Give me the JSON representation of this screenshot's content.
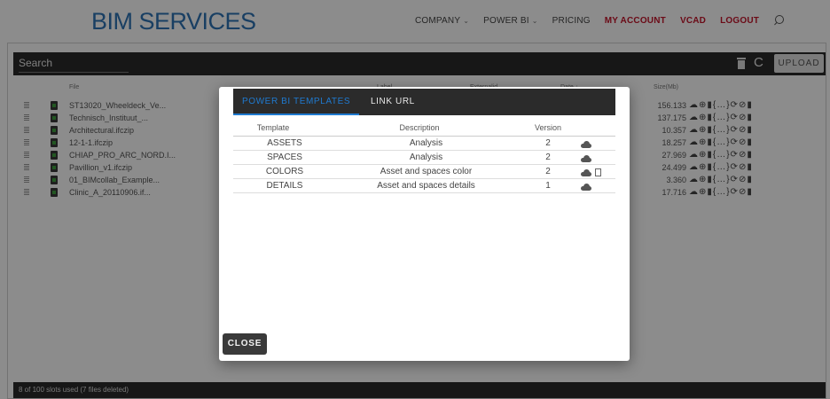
{
  "header": {
    "logo": "BIM SERVICES",
    "nav": [
      {
        "label": "COMPANY",
        "caret": "⌄",
        "highlight": false
      },
      {
        "label": "POWER BI",
        "caret": "⌄",
        "highlight": false
      },
      {
        "label": "PRICING",
        "caret": "",
        "highlight": false
      },
      {
        "label": "MY ACCOUNT",
        "caret": "",
        "highlight": true
      },
      {
        "label": "VCAD",
        "caret": "",
        "highlight": true
      },
      {
        "label": "LOGOUT",
        "caret": "",
        "highlight": true
      }
    ],
    "search_icon": "search-icon"
  },
  "toolbar": {
    "search_placeholder": "Search",
    "refresh_glyph": "C",
    "upload_label": "UPLOAD"
  },
  "table": {
    "headers": {
      "file": "File",
      "label": "Label",
      "externalid": "Externalid",
      "date": "Date ↓",
      "size": "Size(Mb)"
    },
    "rows": [
      {
        "name": "ST13020_Wheeldeck_Ve...",
        "size": "156.133"
      },
      {
        "name": "Technisch_Instituut_...",
        "size": "137.175"
      },
      {
        "name": "Architectural.ifczip",
        "size": "10.357"
      },
      {
        "name": "12-1-1.ifczip",
        "size": "18.257"
      },
      {
        "name": "CHIAP_PRO_ARC_NORD.I...",
        "size": "27.969"
      },
      {
        "name": "Pavillion_v1.ifczip",
        "size": "24.499"
      },
      {
        "name": "01_BIMcollab_Example...",
        "size": "3.360"
      },
      {
        "name": "Clinic_A_20110906.if...",
        "size": "17.716"
      }
    ],
    "action_glyphs": "☁⊕▮{…}⟳⊘▮"
  },
  "footer": {
    "status": "8 of 100 slots used (7 files deleted)"
  },
  "modal": {
    "tabs": [
      {
        "label": "POWER BI TEMPLATES",
        "active": true
      },
      {
        "label": "LINK URL",
        "active": false
      }
    ],
    "columns": {
      "template": "Template",
      "description": "Description",
      "version": "Version"
    },
    "rows": [
      {
        "template": "ASSETS",
        "description": "Analysis",
        "version": "2",
        "extra_doc": false
      },
      {
        "template": "SPACES",
        "description": "Analysis",
        "version": "2",
        "extra_doc": false
      },
      {
        "template": "COLORS",
        "description": "Asset and spaces color",
        "version": "2",
        "extra_doc": true
      },
      {
        "template": "DETAILS",
        "description": "Asset and spaces details",
        "version": "1",
        "extra_doc": false
      }
    ],
    "close_label": "CLOSE"
  },
  "colors": {
    "brand_blue": "#2f74b5",
    "nav_red": "#c4142b",
    "tab_active": "#1f7ad0",
    "toolbar": "#2b2b2b"
  }
}
